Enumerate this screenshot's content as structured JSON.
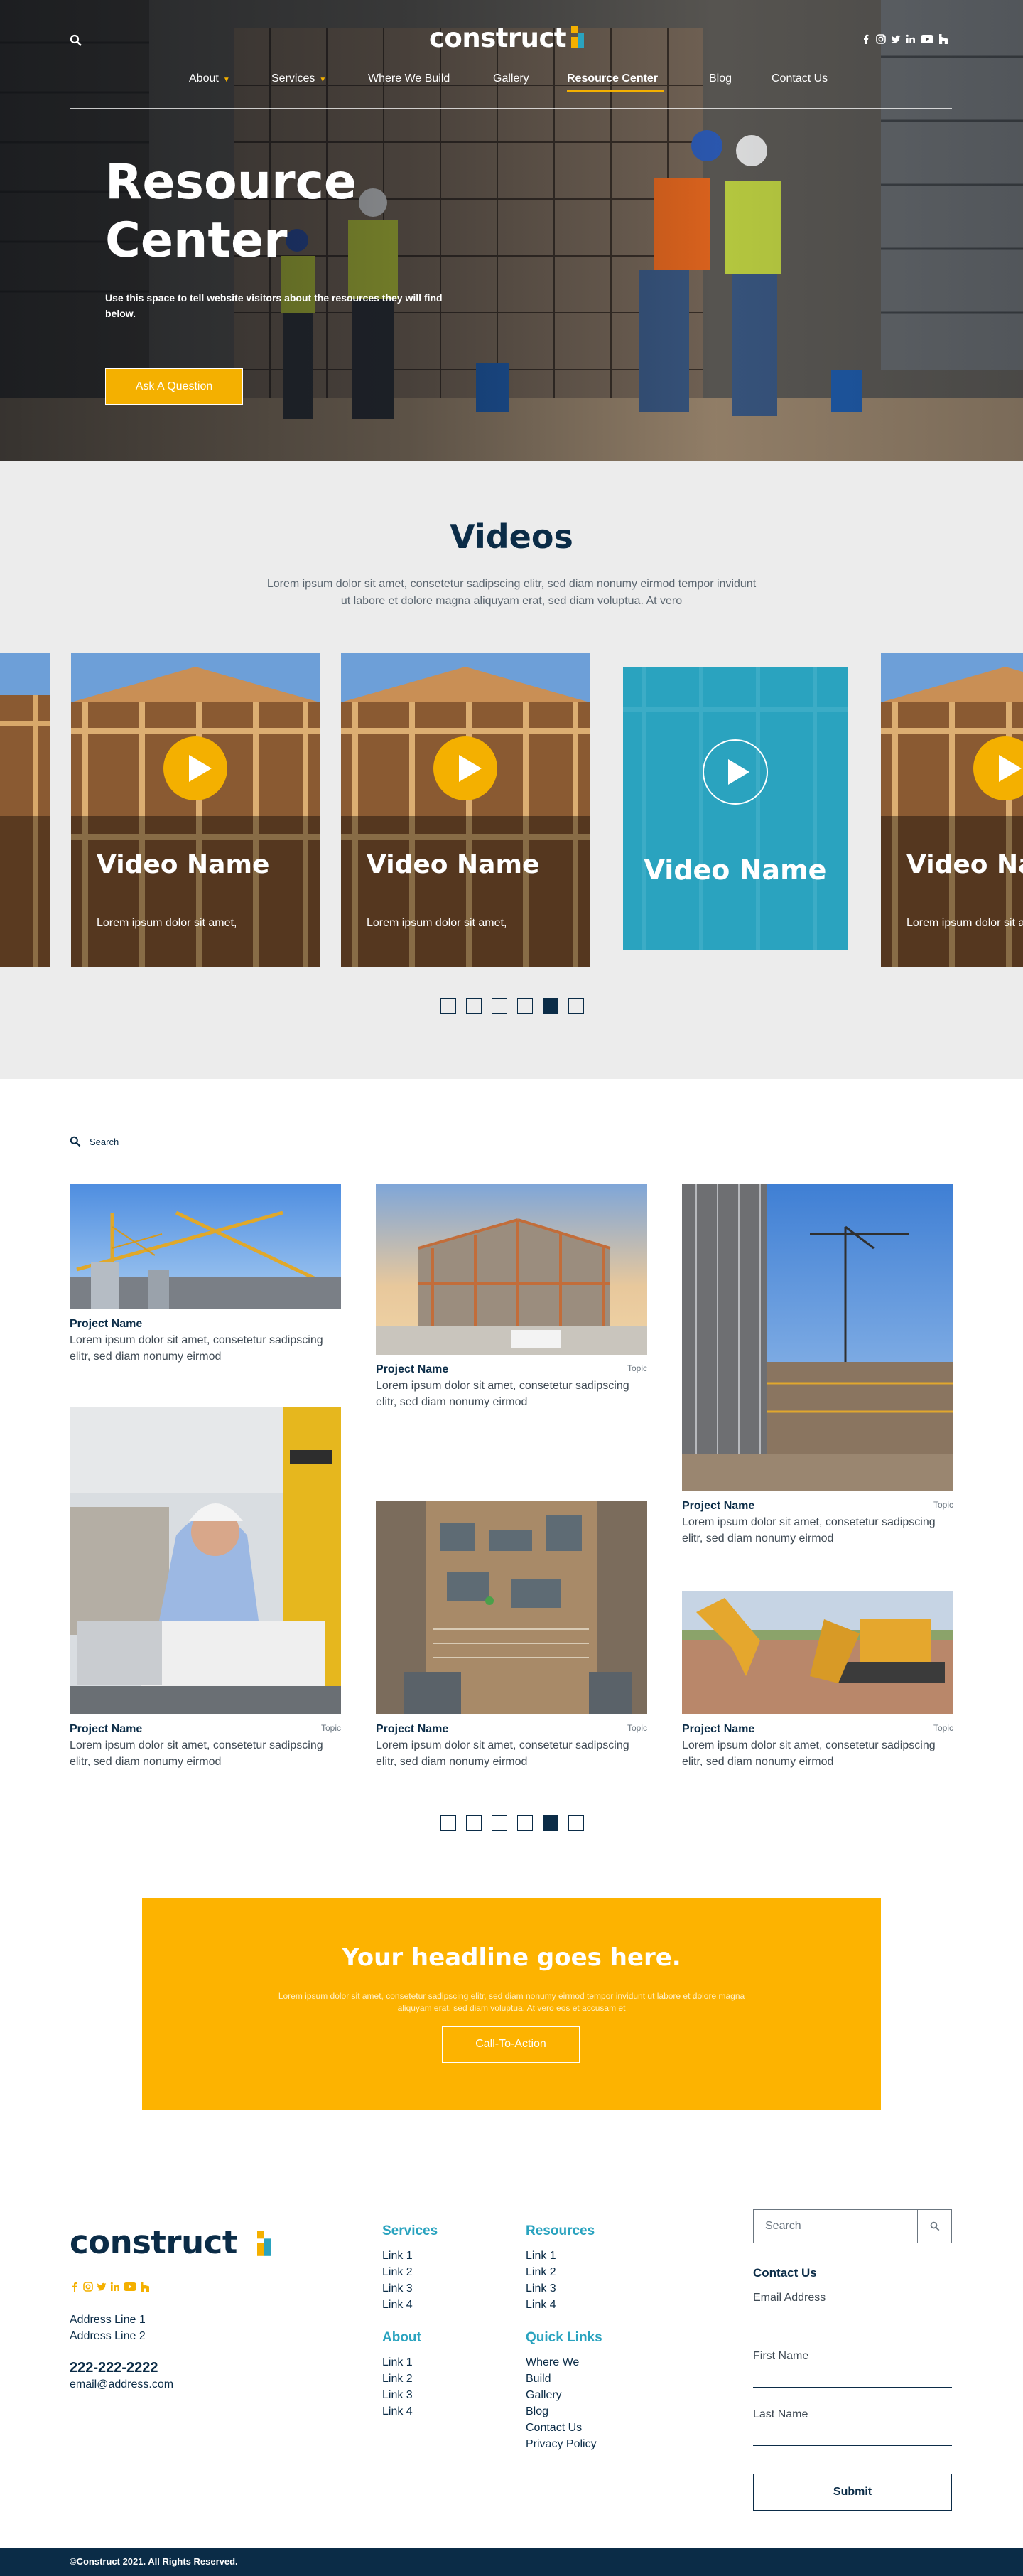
{
  "brand": {
    "name": "construct",
    "accent": "#f4b000",
    "teal": "#2aa3bf",
    "navy": "#0b2c47"
  },
  "header": {
    "nav": [
      {
        "label": "About",
        "dropdown": true
      },
      {
        "label": "Services",
        "dropdown": true
      },
      {
        "label": "Where We Build",
        "dropdown": false
      },
      {
        "label": "Gallery",
        "dropdown": false
      },
      {
        "label": "Resource Center",
        "dropdown": false,
        "active": true
      },
      {
        "label": "Blog",
        "dropdown": false
      },
      {
        "label": "Contact Us",
        "dropdown": false
      }
    ],
    "social_icons": [
      "facebook-icon",
      "instagram-icon",
      "twitter-icon",
      "linkedin-icon",
      "youtube-icon",
      "houzz-icon"
    ]
  },
  "hero": {
    "title_line1": "Resource",
    "title_line2": "Center",
    "subtitle": "Use this space to tell website visitors about the resources they will find below.",
    "button": "Ask A Question"
  },
  "videos": {
    "heading": "Videos",
    "intro": "Lorem ipsum dolor sit amet, consetetur sadipscing elitr, sed diam nonumy eirmod tempor invidunt ut labore et dolore magna aliquyam erat, sed diam voluptua. At vero",
    "cards": [
      {
        "name": "Video Name",
        "desc": "Lorem ipsum dolor sit amet,"
      },
      {
        "name": "Video Name",
        "desc": "Lorem ipsum dolor sit amet,"
      },
      {
        "name": "Video Name",
        "desc": "Lorem ipsum dolor sit amet,"
      },
      {
        "name": "Video Name",
        "desc": "Lorem ipsum dolor sit amet,"
      },
      {
        "name": "Video Name",
        "desc": "Lorem ipsum dolor sit amet,"
      }
    ],
    "pagination": {
      "count": 6,
      "active_index": 4
    }
  },
  "projects": {
    "search_placeholder": "Search",
    "items": [
      {
        "title": "Project Name",
        "topic": "",
        "desc": "Lorem ipsum dolor sit amet, consetetur sadipscing elitr, sed diam nonumy eirmod"
      },
      {
        "title": "Project Name",
        "topic": "Topic",
        "desc": "Lorem ipsum dolor sit amet, consetetur sadipscing elitr, sed diam nonumy eirmod"
      },
      {
        "title": "Project Name",
        "topic": "Topic",
        "desc": "Lorem ipsum dolor sit amet, consetetur sadipscing elitr, sed diam nonumy eirmod"
      },
      {
        "title": "Project Name",
        "topic": "Topic",
        "desc": "Lorem ipsum dolor sit amet, consetetur sadipscing elitr, sed diam nonumy eirmod"
      },
      {
        "title": "Project Name",
        "topic": "Topic",
        "desc": "Lorem ipsum dolor sit amet, consetetur sadipscing elitr, sed diam nonumy eirmod"
      },
      {
        "title": "Project Name",
        "topic": "Topic",
        "desc": "Lorem ipsum dolor sit amet, consetetur sadipscing elitr, sed diam nonumy eirmod"
      }
    ],
    "pagination": {
      "count": 6,
      "active_index": 4
    }
  },
  "cta": {
    "headline": "Your headline goes here.",
    "body": "Lorem ipsum dolor sit amet, consetetur sadipscing elitr, sed diam nonumy eirmod tempor invidunt ut labore et dolore magna aliquyam erat, sed diam voluptua. At vero eos et accusam et",
    "button": "Call-To-Action"
  },
  "footer": {
    "address1": "Address Line 1",
    "address2": "Address Line 2",
    "phone": "222-222-2222",
    "email": "email@address.com",
    "services": {
      "title": "Services",
      "links": [
        "Link 1",
        "Link 2",
        "Link 3",
        "Link 4"
      ]
    },
    "resources": {
      "title": "Resources",
      "links": [
        "Link 1",
        "Link 2",
        "Link 3",
        "Link 4"
      ]
    },
    "about": {
      "title": "About",
      "links": [
        "Link 1",
        "Link 2",
        "Link 3",
        "Link 4"
      ]
    },
    "quick_links": {
      "title": "Quick Links",
      "links": [
        "Where We",
        "Build",
        "Gallery",
        "Blog",
        "Contact Us",
        "Privacy Policy"
      ]
    },
    "search_placeholder": "Search",
    "contact_title": "Contact Us",
    "fields": [
      "Email Address",
      "First Name",
      "Last Name"
    ],
    "submit": "Submit",
    "copyright": "©Construct 2021. All Rights Reserved."
  }
}
